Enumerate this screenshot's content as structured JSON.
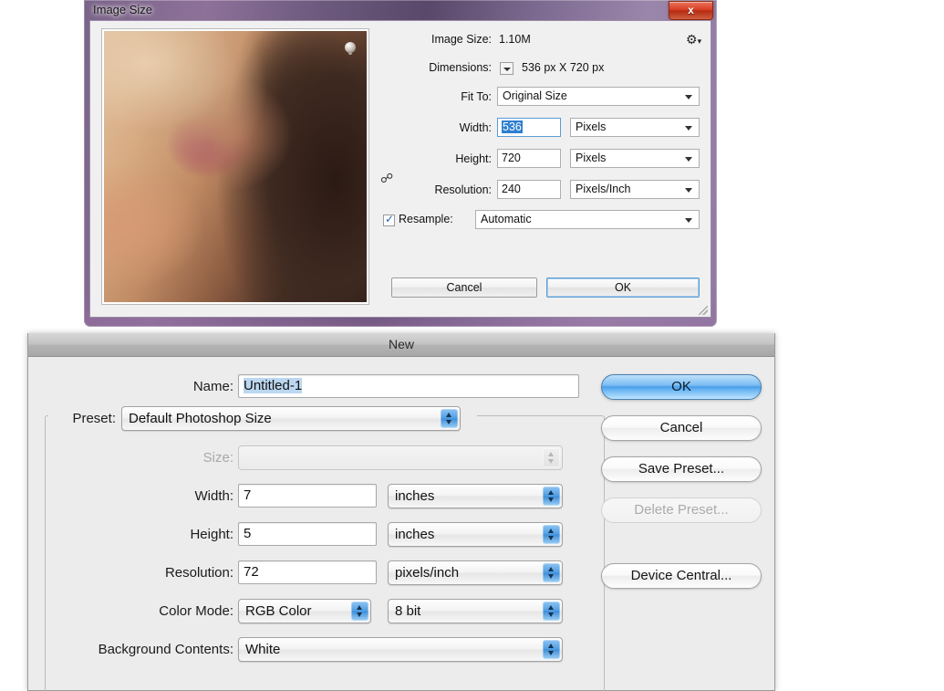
{
  "image_size_dialog": {
    "title": "Image Size",
    "close_label": "x",
    "gear_icon": "gear-icon",
    "image_size_label": "Image Size:",
    "image_size_value": "1.10M",
    "dimensions_label": "Dimensions:",
    "dimensions_value": "536 px X 720 px",
    "fit_to_label": "Fit To:",
    "fit_to_value": "Original Size",
    "width_label": "Width:",
    "width_value": "536",
    "width_unit": "Pixels",
    "height_label": "Height:",
    "height_value": "720",
    "height_unit": "Pixels",
    "resolution_label": "Resolution:",
    "resolution_value": "240",
    "resolution_unit": "Pixels/Inch",
    "resample_label": "Resample:",
    "resample_value": "Automatic",
    "resample_checked": "true",
    "cancel_label": "Cancel",
    "ok_label": "OK",
    "link_icon": "chain-link-icon",
    "preview_alt": "image-preview-thumbnail"
  },
  "new_dialog": {
    "title": "New",
    "name_label": "Name:",
    "name_value": "Untitled-1",
    "preset_label": "Preset:",
    "preset_value": "Default Photoshop Size",
    "size_label": "Size:",
    "size_value": "",
    "width_label": "Width:",
    "width_value": "7",
    "width_unit": "inches",
    "height_label": "Height:",
    "height_value": "5",
    "height_unit": "inches",
    "resolution_label": "Resolution:",
    "resolution_value": "72",
    "resolution_unit": "pixels/inch",
    "color_mode_label": "Color Mode:",
    "color_mode_value": "RGB Color",
    "color_depth_value": "8 bit",
    "background_contents_label": "Background Contents:",
    "background_contents_value": "White",
    "buttons": {
      "ok": "OK",
      "cancel": "Cancel",
      "save_preset": "Save Preset...",
      "delete_preset": "Delete Preset...",
      "device_central": "Device Central..."
    }
  },
  "colors": {
    "accent_blue": "#2f7fd1",
    "aqua_button": "#4a9de8",
    "close_red": "#d63a20",
    "selection_highlight": "#bcd7f0",
    "dialog_gray": "#ececec"
  }
}
